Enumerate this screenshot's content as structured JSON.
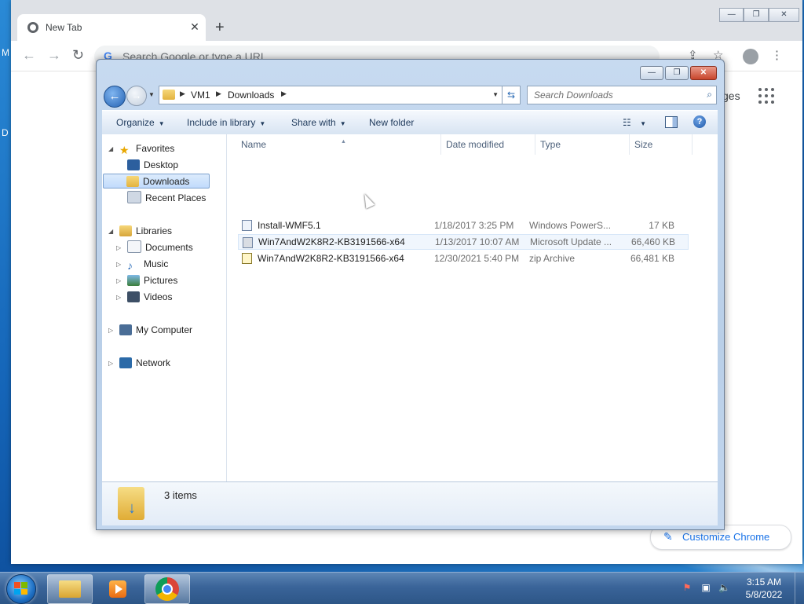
{
  "desktop": {
    "edge_text_1": "M",
    "edge_text_2": "D"
  },
  "chrome": {
    "tab_title": "New Tab",
    "tab_close": "✕",
    "new_tab": "+",
    "omnibox_placeholder": "Search Google or type a URL",
    "ntp_images_link": "ges",
    "customize_label": "Customize Chrome"
  },
  "explorer": {
    "address": [
      "VM1",
      "Downloads"
    ],
    "search_placeholder": "Search Downloads",
    "toolbar": {
      "organize": "Organize",
      "include_in_library": "Include in library",
      "share_with": "Share with",
      "new_folder": "New folder"
    },
    "nav": {
      "favorites": "Favorites",
      "desktop": "Desktop",
      "downloads": "Downloads",
      "recent_places": "Recent Places",
      "libraries": "Libraries",
      "documents": "Documents",
      "music": "Music",
      "pictures": "Pictures",
      "videos": "Videos",
      "my_computer": "My Computer",
      "network": "Network"
    },
    "columns": {
      "name": "Name",
      "date": "Date modified",
      "type": "Type",
      "size": "Size"
    },
    "files": [
      {
        "name": "Install-WMF5.1",
        "date": "1/18/2017 3:25 PM",
        "type": "Windows PowerS...",
        "size": "17 KB"
      },
      {
        "name": "Win7AndW2K8R2-KB3191566-x64",
        "date": "1/13/2017 10:07 AM",
        "type": "Microsoft Update ...",
        "size": "66,460 KB"
      },
      {
        "name": "Win7AndW2K8R2-KB3191566-x64",
        "date": "12/30/2021 5:40 PM",
        "type": "zip Archive",
        "size": "66,481 KB"
      }
    ],
    "item_count": "3 items"
  },
  "taskbar": {
    "time": "3:15 AM",
    "date": "5/8/2022"
  }
}
